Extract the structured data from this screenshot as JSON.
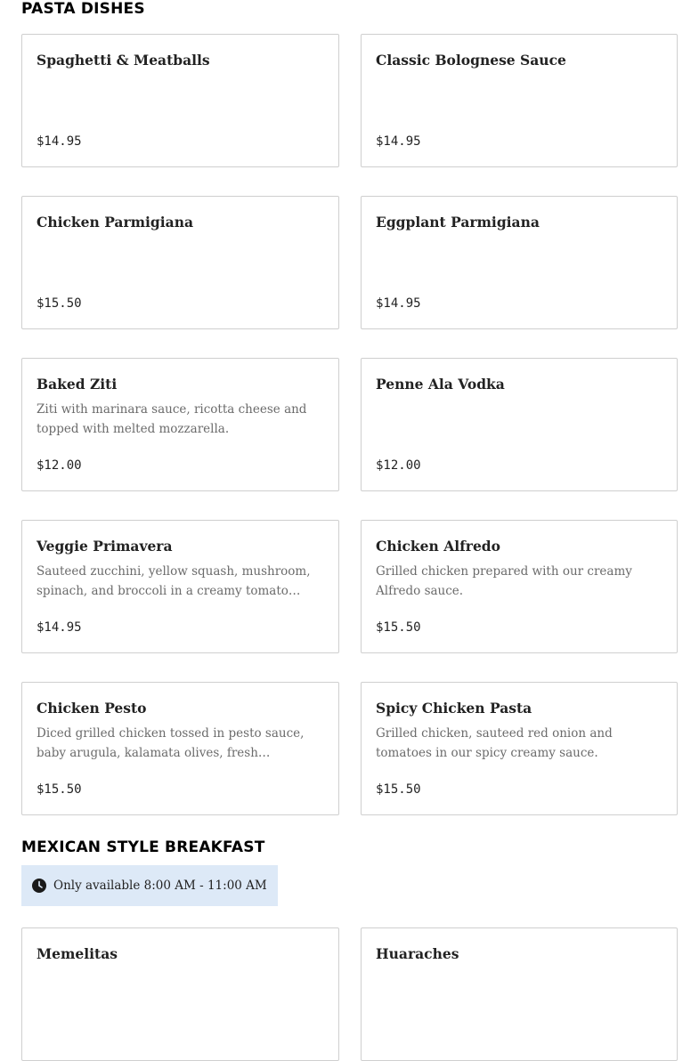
{
  "sections": [
    {
      "title": "PASTA DISHES",
      "items": [
        {
          "name": "Spaghetti & Meatballs",
          "description": "",
          "price": "$14.95"
        },
        {
          "name": "Classic Bolognese Sauce",
          "description": "",
          "price": "$14.95"
        },
        {
          "name": "Chicken Parmigiana",
          "description": "",
          "price": "$15.50"
        },
        {
          "name": "Eggplant Parmigiana",
          "description": "",
          "price": "$14.95"
        },
        {
          "name": "Baked Ziti",
          "description": "Ziti with marinara sauce, ricotta cheese and topped with melted mozzarella.",
          "price": "$12.00"
        },
        {
          "name": "Penne Ala Vodka",
          "description": "",
          "price": "$12.00"
        },
        {
          "name": "Veggie Primavera",
          "description": "Sauteed zucchini, yellow squash, mushroom, spinach, and broccoli in a creamy tomato sauce.",
          "price": "$14.95"
        },
        {
          "name": "Chicken Alfredo",
          "description": "Grilled chicken prepared with our creamy Alfredo sauce.",
          "price": "$15.50"
        },
        {
          "name": "Chicken Pesto",
          "description": "Diced grilled chicken tossed in pesto sauce, baby arugula, kalamata olives, fresh mozzarella and…",
          "price": "$15.50"
        },
        {
          "name": "Spicy Chicken Pasta",
          "description": "Grilled chicken, sauteed red onion and tomatoes in our spicy creamy sauce.",
          "price": "$15.50"
        }
      ]
    },
    {
      "title": "MEXICAN STYLE BREAKFAST",
      "notice": {
        "icon": "clock-icon",
        "text": "Only available 8:00 AM - 11:00 AM"
      },
      "items": [
        {
          "name": "Memelitas",
          "description": "",
          "price": ""
        },
        {
          "name": "Huaraches",
          "description": "",
          "price": ""
        }
      ]
    }
  ],
  "colors": {
    "notice_bg": "#dde9f7",
    "card_border": "#cfcfcf"
  }
}
